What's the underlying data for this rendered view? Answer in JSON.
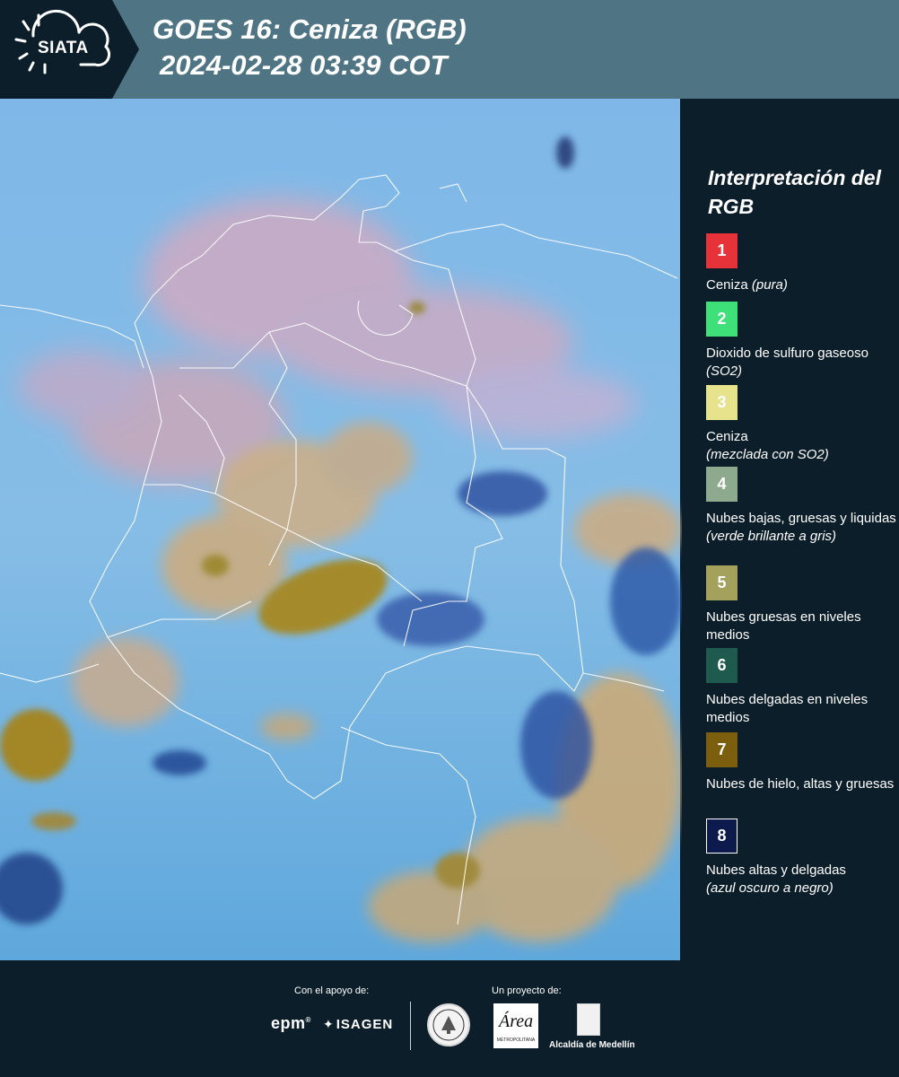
{
  "header": {
    "logo_text": "SIATA",
    "title_line1": "GOES 16: Ceniza (RGB)",
    "title_line2": "2024-02-28 03:39 COT",
    "background": "#4f7584"
  },
  "map": {
    "description_icon": "satellite-rgb-ash-image",
    "base_color": "#6fb3e0",
    "colors": {
      "ocean_blue": "#73b4e6",
      "pink_haze": "#d7a6b8",
      "tan_cloud": "#c9a97a",
      "olive_cloud": "#a48a2a",
      "dark_blue_cloud": "#1d3a78",
      "border_line": "#ffffff"
    }
  },
  "legend": {
    "title": "Interpretación del RGB",
    "items": [
      {
        "number": "1",
        "color": "#e8323a",
        "label": "Ceniza ",
        "note": "(pura)"
      },
      {
        "number": "2",
        "color": "#3ee07a",
        "label": "Dioxido de sulfuro gaseoso ",
        "note": "(SO2)"
      },
      {
        "number": "3",
        "color": "#e6e38c",
        "label": "Ceniza ",
        "note": "(mezclada con SO2)"
      },
      {
        "number": "4",
        "color": "#8eaa8e",
        "label": "Nubes bajas, gruesas y liquidas ",
        "note": "(verde brillante a gris)"
      },
      {
        "number": "5",
        "color": "#a4a15c",
        "label": "Nubes gruesas en niveles medios",
        "note": ""
      },
      {
        "number": "6",
        "color": "#1f5a4e",
        "label": "Nubes delgadas en niveles medios",
        "note": ""
      },
      {
        "number": "7",
        "color": "#7c5f0e",
        "label": "Nubes de hielo, altas y gruesas",
        "note": ""
      },
      {
        "number": "8",
        "color": "#0c1a4e",
        "label": "Nubes altas y delgadas ",
        "note": "(azul oscuro a negro)"
      }
    ]
  },
  "footer": {
    "support_caption": "Con el apoyo de:",
    "project_caption": "Un proyecto de:",
    "sponsor_1": "epm",
    "sponsor_1_mark": "®",
    "sponsor_2": "ISAGEN",
    "partner_1_icon": "seal-icon",
    "partner_2": "Área",
    "partner_2_sub": "METROPOLITANA",
    "partner_3": "Alcaldía de Medellín"
  }
}
